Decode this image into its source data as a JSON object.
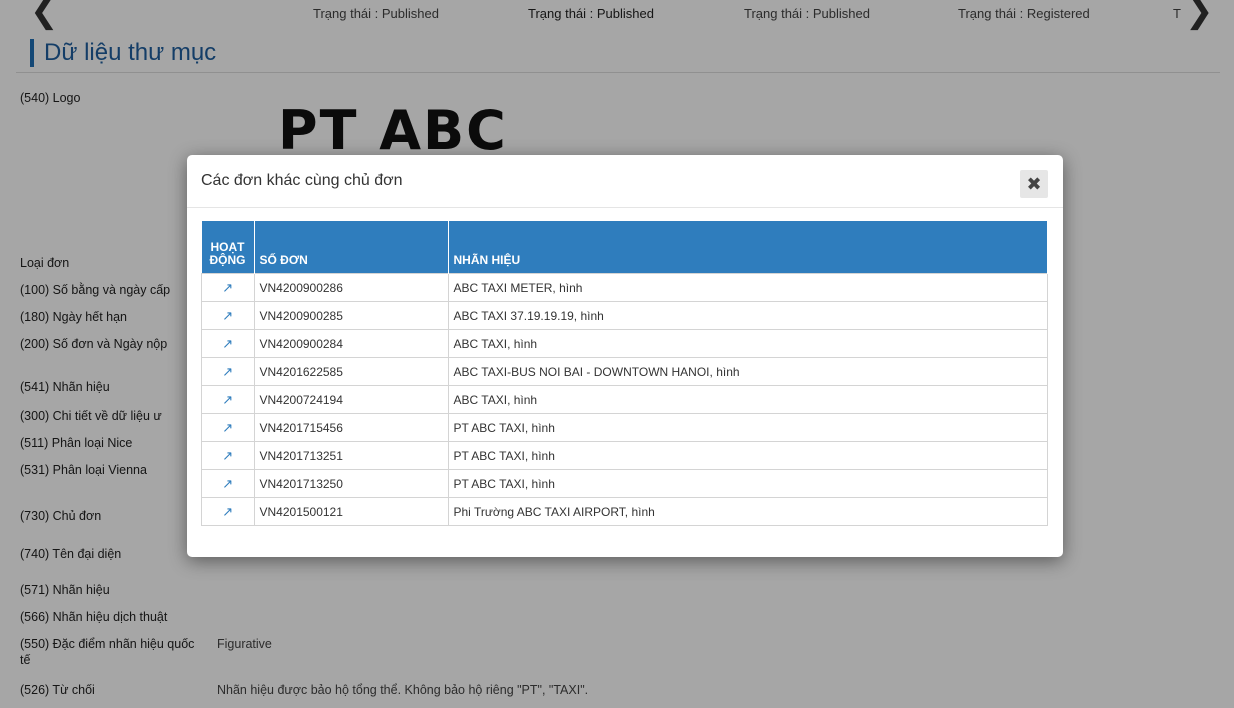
{
  "nav": {
    "prev_icon": "chevron-left-icon",
    "next_icon": "chevron-right-icon",
    "statuses": [
      "Trạng thái : Published",
      "Trạng thái : Published",
      "Trạng thái : Published",
      "Trạng thái : Registered",
      "T"
    ]
  },
  "section": {
    "title": "Dữ liệu thư mục"
  },
  "fields": [
    {
      "label": "(540) Logo",
      "value": ""
    },
    {
      "label": "Loại đơn",
      "value": ""
    },
    {
      "label": "(100) Số bằng và ngày cấp",
      "value": ""
    },
    {
      "label": "(180) Ngày hết hạn",
      "value": ""
    },
    {
      "label": "(200) Số đơn và Ngày nộp",
      "value": ""
    },
    {
      "label": "(541) Nhãn hiệu",
      "value": ""
    },
    {
      "label": "(300) Chi tiết về dữ liệu ư",
      "value": ""
    },
    {
      "label": "(511) Phân loại Nice",
      "value": ""
    },
    {
      "label": "(531) Phân loại Vienna",
      "value": ""
    },
    {
      "label": "(730) Chủ đơn",
      "value": ""
    },
    {
      "label": "(740) Tên đại diện",
      "value": ""
    },
    {
      "label": "(571) Nhãn hiệu",
      "value": ""
    },
    {
      "label": "(566) Nhãn hiệu dịch thuật",
      "value": ""
    },
    {
      "label": "(550) Đặc điểm nhãn hiệu quốc",
      "label2": "tế",
      "value": "Figurative"
    },
    {
      "label": "(526) Từ chối",
      "value": "Nhãn hiệu được bảo hộ tổng thể. Không bảo hộ riêng \"PT\", \"TAXI\"."
    }
  ],
  "logo": {
    "text": "PT ABC"
  },
  "modal": {
    "title": "Các đơn khác cùng chủ đơn",
    "close_icon": "close-icon",
    "close_glyph": "✖",
    "columns": {
      "action": "HOẠT ĐỘNG",
      "number": "SỐ ĐƠN",
      "mark": "NHÃN HIỆU"
    },
    "link_glyph": "↗",
    "rows": [
      {
        "number": "VN4200900286",
        "mark": "ABC TAXI METER, hình"
      },
      {
        "number": "VN4200900285",
        "mark": "ABC TAXI 37.19.19.19, hình"
      },
      {
        "number": "VN4200900284",
        "mark": "ABC TAXI, hình"
      },
      {
        "number": "VN4201622585",
        "mark": "ABC TAXI-BUS NOI BAI - DOWNTOWN HANOI, hình"
      },
      {
        "number": "VN4200724194",
        "mark": "ABC TAXI, hình"
      },
      {
        "number": "VN4201715456",
        "mark": "PT ABC TAXI, hình"
      },
      {
        "number": "VN4201713251",
        "mark": "PT ABC TAXI, hình"
      },
      {
        "number": "VN4201713250",
        "mark": "PT ABC TAXI, hình"
      },
      {
        "number": "VN4201500121",
        "mark": "Phi Trường ABC TAXI AIRPORT, hình"
      }
    ]
  },
  "colors": {
    "header_blue": "#2f7dbd",
    "title_blue": "#1f5f9f",
    "overlay": "rgba(0,0,0,0.35)"
  }
}
